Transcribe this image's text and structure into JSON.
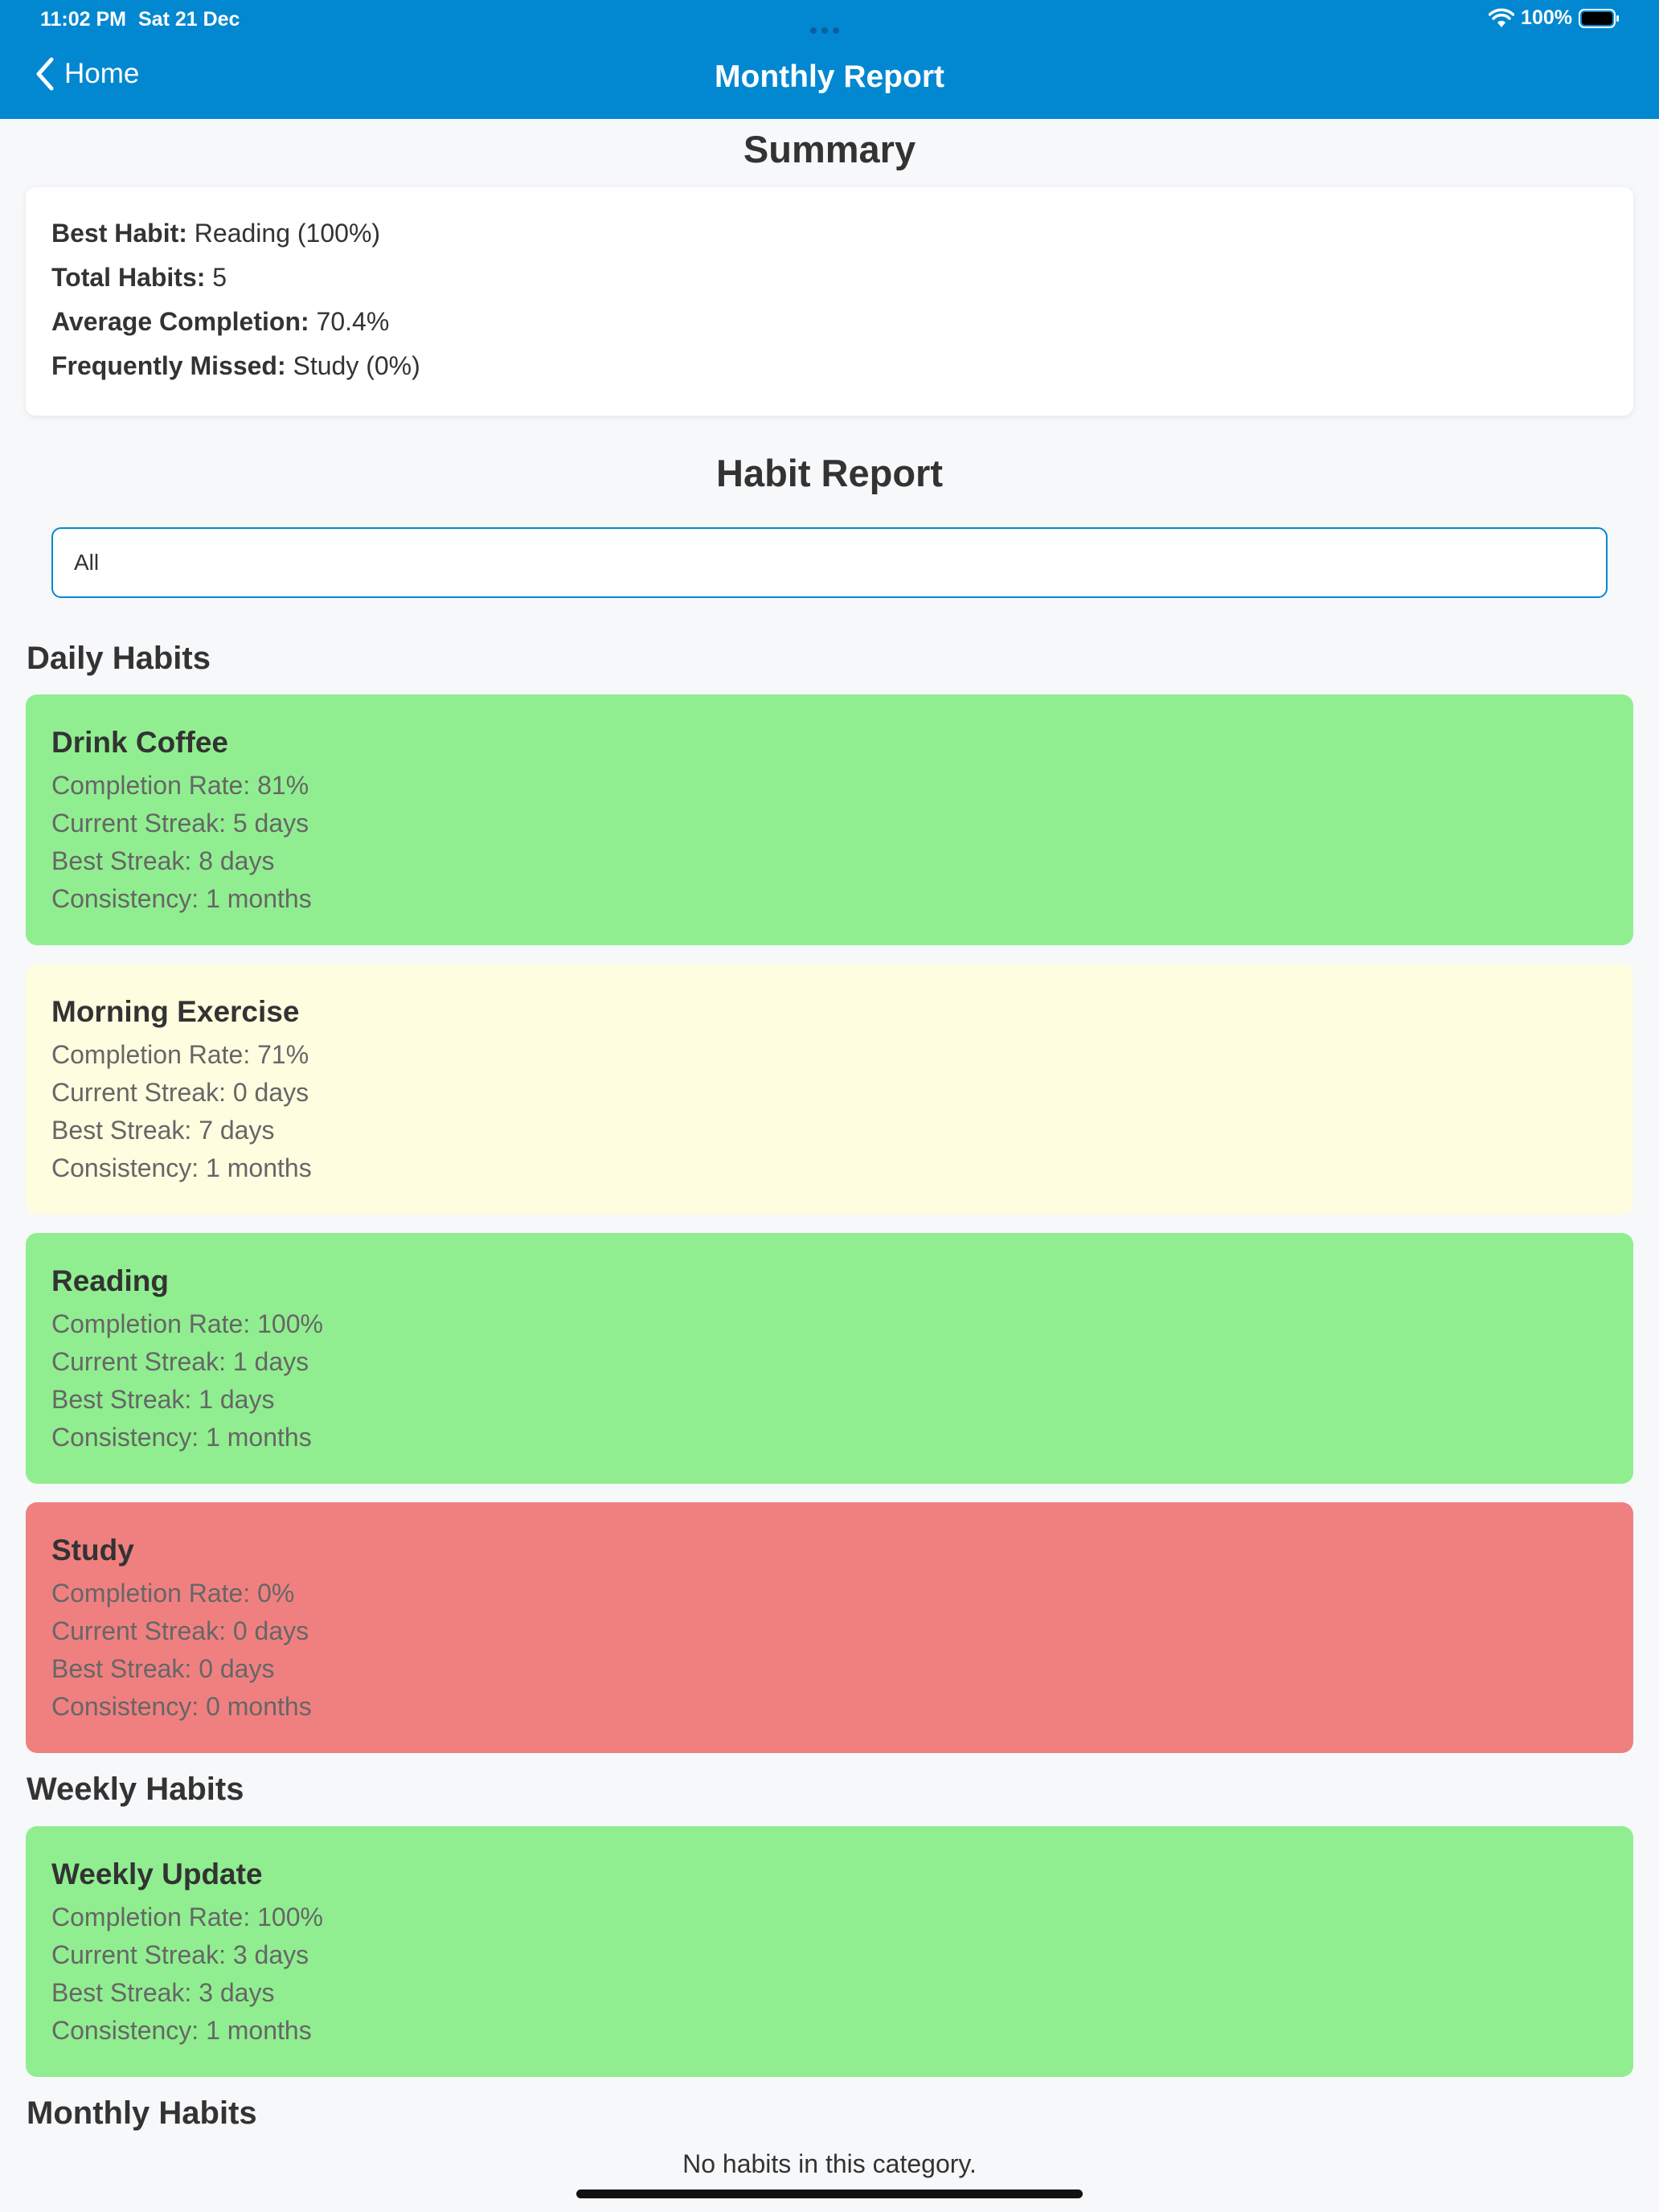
{
  "status": {
    "time": "11:02 PM",
    "date": "Sat 21 Dec",
    "battery": "100%"
  },
  "nav": {
    "back_label": "Home",
    "title": "Monthly Report"
  },
  "summary": {
    "heading": "Summary",
    "rows": [
      {
        "label": "Best Habit:",
        "value": "Reading (100%)"
      },
      {
        "label": "Total Habits:",
        "value": "5"
      },
      {
        "label": "Average Completion:",
        "value": "70.4%"
      },
      {
        "label": "Frequently Missed:",
        "value": "Study (0%)"
      }
    ]
  },
  "report": {
    "heading": "Habit Report",
    "filter_value": "All"
  },
  "colors": {
    "header": "#0288d1",
    "good": "#90ee90",
    "medium": "#fffde0",
    "poor": "#f08080"
  },
  "groups": {
    "daily": {
      "heading": "Daily Habits",
      "habits": [
        {
          "name": "Drink Coffee",
          "completion": "Completion Rate: 81%",
          "current_streak": "Current Streak: 5 days",
          "best_streak": "Best Streak: 8 days",
          "consistency": "Consistency: 1 months",
          "status": "good"
        },
        {
          "name": "Morning Exercise",
          "completion": "Completion Rate: 71%",
          "current_streak": "Current Streak: 0 days",
          "best_streak": "Best Streak: 7 days",
          "consistency": "Consistency: 1 months",
          "status": "medium"
        },
        {
          "name": "Reading",
          "completion": "Completion Rate: 100%",
          "current_streak": "Current Streak: 1 days",
          "best_streak": "Best Streak: 1 days",
          "consistency": "Consistency: 1 months",
          "status": "good"
        },
        {
          "name": "Study",
          "completion": "Completion Rate: 0%",
          "current_streak": "Current Streak: 0 days",
          "best_streak": "Best Streak: 0 days",
          "consistency": "Consistency: 0 months",
          "status": "poor"
        }
      ]
    },
    "weekly": {
      "heading": "Weekly Habits",
      "habits": [
        {
          "name": "Weekly Update",
          "completion": "Completion Rate: 100%",
          "current_streak": "Current Streak: 3 days",
          "best_streak": "Best Streak: 3 days",
          "consistency": "Consistency: 1 months",
          "status": "good"
        }
      ]
    },
    "monthly": {
      "heading": "Monthly Habits",
      "empty_message": "No habits in this category."
    }
  }
}
